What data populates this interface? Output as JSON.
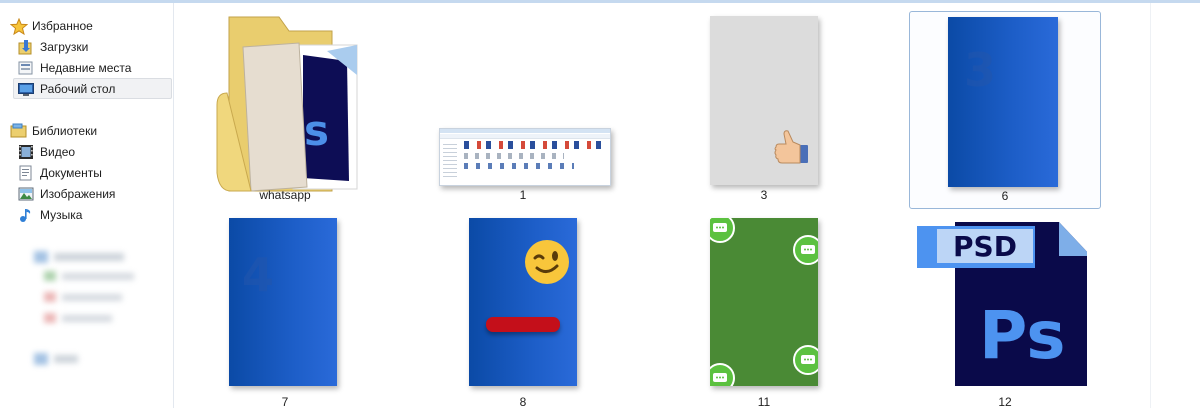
{
  "sidebar": {
    "favorites": {
      "label": "Избранное",
      "items": [
        {
          "label": "Загрузки",
          "icon": "downloads-folder-icon"
        },
        {
          "label": "Недавние места",
          "icon": "recent-places-icon"
        },
        {
          "label": "Рабочий стол",
          "icon": "desktop-icon",
          "selected": true
        }
      ]
    },
    "libraries": {
      "label": "Библиотеки",
      "items": [
        {
          "label": "Видео",
          "icon": "video-library-icon"
        },
        {
          "label": "Документы",
          "icon": "documents-library-icon"
        },
        {
          "label": "Изображения",
          "icon": "pictures-library-icon"
        },
        {
          "label": "Музыка",
          "icon": "music-library-icon"
        }
      ]
    }
  },
  "files": [
    {
      "name": "whatsapp",
      "type": "folder"
    },
    {
      "name": "1",
      "type": "image"
    },
    {
      "name": "3",
      "type": "image"
    },
    {
      "name": "6",
      "type": "image",
      "selected": true,
      "digit": "3"
    },
    {
      "name": "7",
      "type": "image",
      "digit": "4"
    },
    {
      "name": "8",
      "type": "image"
    },
    {
      "name": "11",
      "type": "image"
    },
    {
      "name": "12",
      "type": "psd",
      "badge": "PSD",
      "logo": "Ps"
    }
  ],
  "colors": {
    "selection_border": "#99b7d9",
    "page_blue": "#1d5ec8",
    "chat_green": "#4a8a35",
    "psd_navy": "#0a0a4a",
    "psd_label_blue": "#4d93f0"
  }
}
